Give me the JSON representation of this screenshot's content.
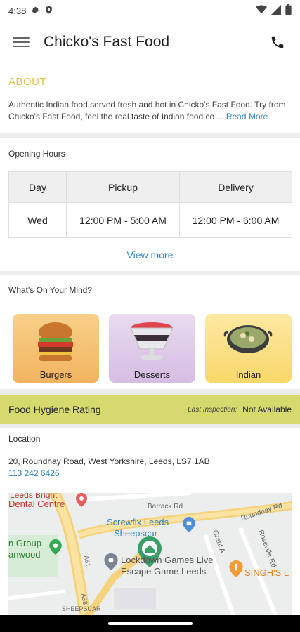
{
  "status_bar": {
    "time": "4:38"
  },
  "app_bar": {
    "title": "Chicko's Fast Food"
  },
  "about": {
    "heading": "ABOUT",
    "description": "Authentic Indian food served fresh and hot in Chicko's Fast Food. Try from Chicko's Fast Food, feel the real taste of Indian food co ...",
    "read_more": "Read More"
  },
  "opening_hours": {
    "label": "Opening Hours",
    "headers": [
      "Day",
      "Pickup",
      "Delivery"
    ],
    "row": {
      "day": "Wed",
      "pickup": "12:00 PM - 5:00 AM",
      "delivery": "12:00 PM - 6:00 AM"
    },
    "view_more": "View more"
  },
  "mind": {
    "label": "What's On Your Mind?",
    "categories": [
      {
        "label": "Burgers",
        "bg": "#f5c27a"
      },
      {
        "label": "Desserts",
        "bg": "#d9c4e4"
      },
      {
        "label": "Indian",
        "bg": "#fbe08c"
      }
    ]
  },
  "hygiene": {
    "title": "Food Hygiene Rating",
    "inspection_label": "Last Inspection:",
    "inspection_value": "Not Available",
    "color": "#d6da6e"
  },
  "location": {
    "label": "Location",
    "address": "20, Roundhay Road, West Yorkshire, Leeds, LS7 1AB",
    "phone": "113 242 6426"
  },
  "map": {
    "labels": {
      "dental": "Dental Centre",
      "leeds_bright": "Leeds Bright",
      "barrack": "Barrack Rd",
      "roundhay": "Roundhay Rd",
      "screwfix1": "Screwfix Leeds",
      "screwfix2": "- Sheepscar",
      "group": "n Group",
      "anwood": "anwood",
      "lockdown1": "Lockdown Games Live",
      "lockdown2": "Escape Game Leeds",
      "singh": "SINGH'S L",
      "sheepscar": "SHEEPSCAR",
      "grant": "Grant A",
      "roseville": "Roseville Rd",
      "a58": "A58",
      "a61": "A61"
    }
  },
  "colors": {
    "accent_yellow": "#e3c14c",
    "link_blue": "#2e86c1"
  }
}
